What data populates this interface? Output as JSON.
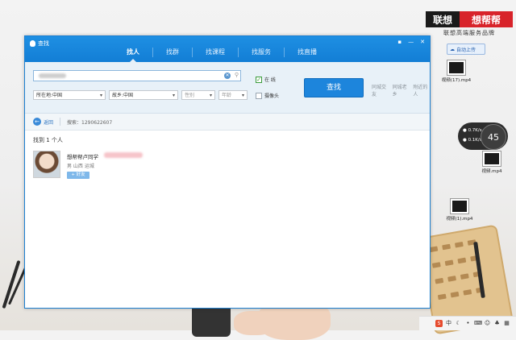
{
  "window": {
    "title": "查找",
    "tabs": [
      "找人",
      "找群",
      "找课程",
      "找服务",
      "找直播"
    ],
    "active_tab": "找人"
  },
  "search": {
    "value": "",
    "location_select": "所在地:中国",
    "hometown_select": "故乡:中国",
    "gender_select": "性别",
    "age_select": "年龄",
    "online_label": "在 线",
    "online_checked": true,
    "camera_label": "摄像头",
    "camera_checked": false,
    "find_button": "查找",
    "links": [
      "同城交友",
      "同城老乡",
      "附近的人"
    ]
  },
  "breadcrumb": {
    "back_label": "返回",
    "query_text": "搜索：1290622607"
  },
  "results": {
    "count_text": "找到 1 个人",
    "items": [
      {
        "name": "想帮帮卢同学",
        "location": "男 山西 运城",
        "add_label": "+ 好友"
      }
    ]
  },
  "desktop": {
    "brand_left": "联想",
    "brand_right": "想帮帮",
    "brand_sub": "联想高端服务品牌",
    "upload_button": "自动上传",
    "files": [
      "视频(17).mp4",
      "视频.mp4",
      "视频(1).mp4"
    ],
    "netmon": {
      "down": "0.7K/s",
      "up": "0.1K/s",
      "value": "45"
    },
    "tray_ime": "中"
  },
  "colors": {
    "accent": "#1d85dc",
    "titlebar": "#137ed5",
    "brand_red": "#d8232a"
  }
}
